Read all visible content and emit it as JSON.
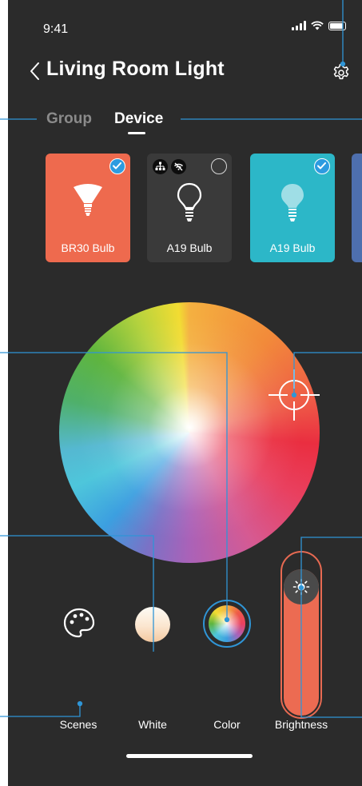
{
  "status_bar": {
    "time": "9:41"
  },
  "header": {
    "title": "Living Room Light",
    "back_icon": "chevron-left-icon",
    "settings_icon": "gear-icon"
  },
  "tabs": [
    {
      "label": "Group",
      "active": false
    },
    {
      "label": "Device",
      "active": true
    }
  ],
  "devices": [
    {
      "label": "BR30 Bulb",
      "color": "#ee6a4e",
      "selected": true,
      "icon": "br30-bulb-icon"
    },
    {
      "label": "A19 Bulb",
      "color": "#3a3a3a",
      "selected": false,
      "icon": "a19-bulb-icon",
      "badges": [
        "network-hub-icon",
        "wifi-off-icon"
      ]
    },
    {
      "label": "A19 Bulb",
      "color": "#2cb7c8",
      "selected": true,
      "icon": "a19-bulb-icon"
    }
  ],
  "brightness": {
    "icon": "sun-icon",
    "accent": "#ec6b52"
  },
  "mode_bar": {
    "scenes": "Scenes",
    "white": "White",
    "color": "Color",
    "brightness": "Brightness",
    "selected": "Color"
  },
  "colors": {
    "background": "#2b2b2b",
    "accent_blue": "#2f95d6",
    "callout": "#2f95d6"
  }
}
